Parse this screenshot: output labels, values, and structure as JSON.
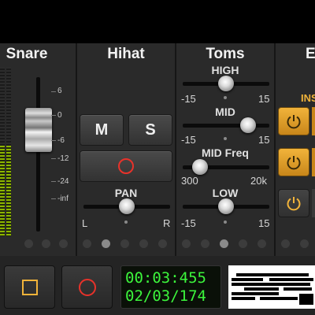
{
  "channels": {
    "snare": {
      "name": "Snare"
    },
    "hihat": {
      "name": "Hihat"
    },
    "toms": {
      "name": "Toms"
    },
    "partial": {
      "name": "E"
    }
  },
  "snare_fader": {
    "scale": [
      "6",
      "0",
      "-6",
      "-12",
      "-24",
      "-inf"
    ]
  },
  "hihat": {
    "mute_label": "M",
    "solo_label": "S",
    "pan": {
      "title": "PAN",
      "min_label": "L",
      "max_label": "R",
      "value": 0.5
    }
  },
  "toms": {
    "high": {
      "title": "HIGH",
      "min": "-15",
      "max": "15",
      "value": 0.5
    },
    "mid": {
      "title": "MID",
      "min": "-15",
      "max": "15",
      "value": 0.75
    },
    "mid_freq": {
      "title": "MID Freq",
      "min": "300",
      "max": "20k",
      "value": 0.2
    },
    "low": {
      "title": "LOW",
      "min": "-15",
      "max": "15",
      "value": 0.5
    }
  },
  "insert": {
    "label": "INS",
    "slots": [
      {
        "on": true
      },
      {
        "on": true
      },
      {
        "on": false
      }
    ]
  },
  "transport": {
    "time": "00:03:455",
    "position": "02/03/174"
  },
  "colors": {
    "accent_orange": "#f1b33a",
    "record_red": "#e8322a",
    "meter_green": "#8db500",
    "lcd_green": "#3cf53c"
  },
  "icons": [
    "record-icon",
    "stop-icon",
    "power-icon"
  ]
}
